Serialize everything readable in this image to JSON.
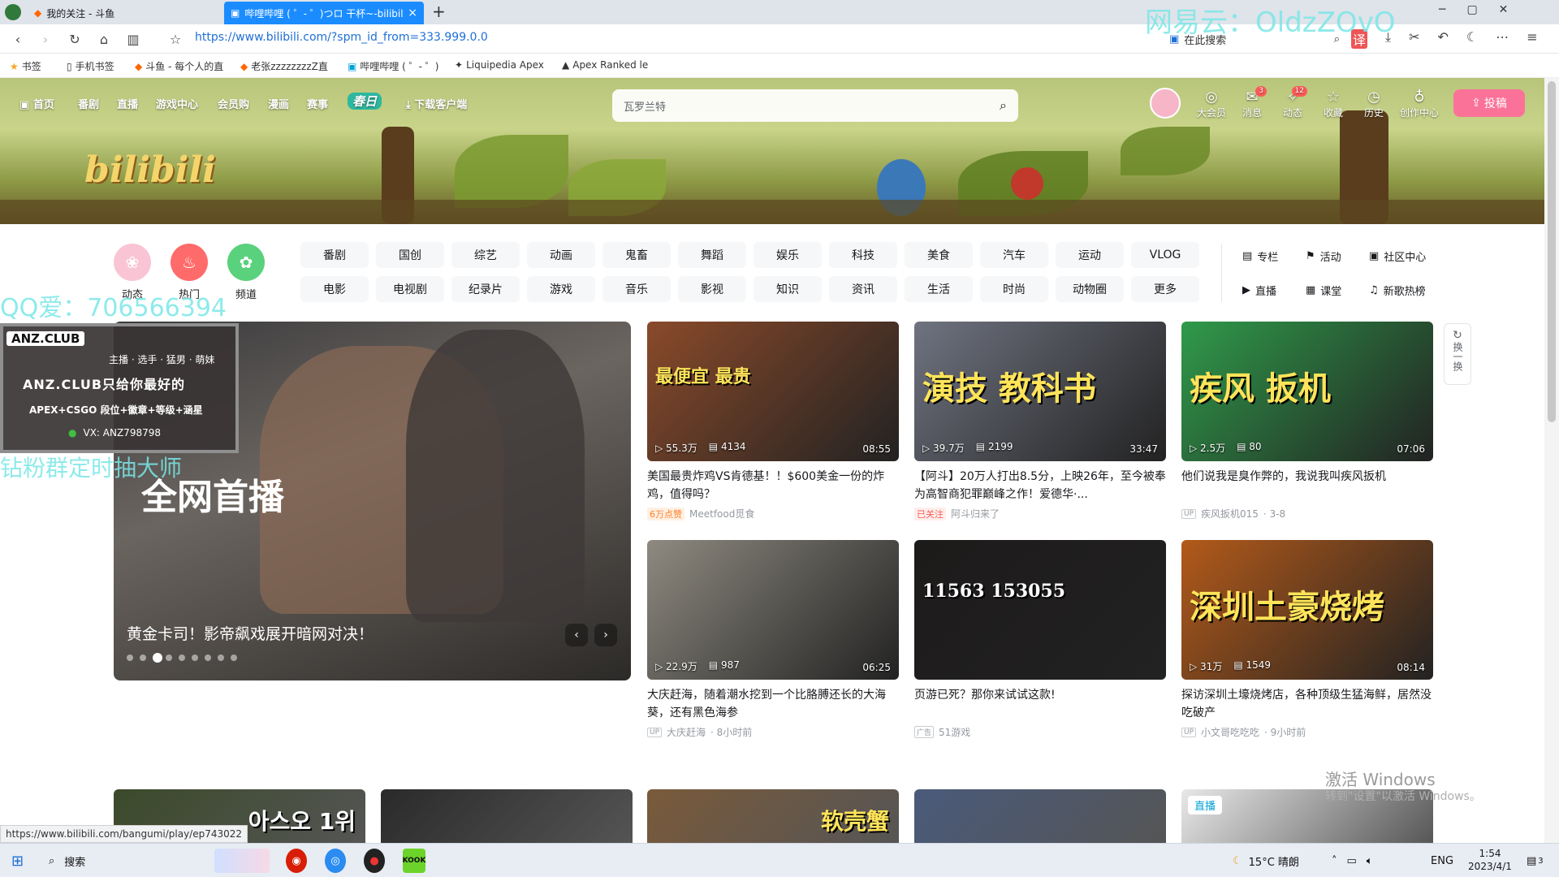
{
  "browser": {
    "tabs": [
      {
        "label": "我的关注 - 斗鱼"
      },
      {
        "label": "哔哩哔哩 ( ゜- ゜)つロ 干杯~-bilibili"
      }
    ],
    "new_tab": "+",
    "url": "https://www.bilibili.com/?spm_id_from=333.999.0.0",
    "search_placeholder": "在此搜索",
    "bookmarks": [
      {
        "label": "书签"
      },
      {
        "label": "手机书签"
      },
      {
        "label": "斗鱼 - 每个人的直"
      },
      {
        "label": "老张zzzzzzzzZ直"
      },
      {
        "label": "哔哩哔哩 ( ゜- ゜)"
      },
      {
        "label": "Liquipedia Apex"
      },
      {
        "label": "Apex Ranked le"
      }
    ]
  },
  "header": {
    "nav": [
      {
        "label": "首页"
      },
      {
        "label": "番剧"
      },
      {
        "label": "直播"
      },
      {
        "label": "游戏中心"
      },
      {
        "label": "会员购"
      },
      {
        "label": "漫画"
      },
      {
        "label": "赛事"
      },
      {
        "label": "春日"
      },
      {
        "label": "下载客户端"
      }
    ],
    "search_placeholder": "瓦罗兰特",
    "right": [
      {
        "label": "大会员",
        "icon": "vip-icon",
        "badge": ""
      },
      {
        "label": "消息",
        "icon": "message-icon",
        "badge": "3"
      },
      {
        "label": "动态",
        "icon": "dynamic-icon",
        "badge": "12"
      },
      {
        "label": "收藏",
        "icon": "star-icon",
        "badge": ""
      },
      {
        "label": "历史",
        "icon": "history-icon",
        "badge": ""
      },
      {
        "label": "创作中心",
        "icon": "bulb-icon",
        "badge": ""
      }
    ],
    "upload": "投稿",
    "logo": "bilibili"
  },
  "channels": {
    "circles": [
      {
        "label": "动态",
        "color": "#f9c5d4"
      },
      {
        "label": "热门",
        "color": "#ff6b6b"
      },
      {
        "label": "频道",
        "color": "#5ad17c"
      }
    ],
    "row1": [
      "番剧",
      "国创",
      "综艺",
      "动画",
      "鬼畜",
      "舞蹈",
      "娱乐",
      "科技",
      "美食",
      "汽车",
      "运动",
      "VLOG"
    ],
    "row2": [
      "电影",
      "电视剧",
      "纪录片",
      "游戏",
      "音乐",
      "影视",
      "知识",
      "资讯",
      "生活",
      "时尚",
      "动物圈",
      "更多"
    ],
    "side": [
      "专栏",
      "活动",
      "社区中心",
      "直播",
      "课堂",
      "新歌热榜"
    ]
  },
  "carousel": {
    "title": "黄金卡司！影帝飙戏展开暗网对决！",
    "overlay_text": "全网首播",
    "dot_count": 9,
    "active_dot": 2
  },
  "videos": [
    {
      "views": "55.3万",
      "danmaku": "4134",
      "duration": "08:55",
      "title": "美国最贵炸鸡VS肯德基！！$600美金一份的炸鸡，值得吗？",
      "tag": "6万点赞",
      "tag_type": "orange",
      "author": "Meetfood觅食",
      "date": "",
      "thumb_text": "最便宜    最贵",
      "thumb_color": "#8a4a2a"
    },
    {
      "views": "39.7万",
      "danmaku": "2199",
      "duration": "33:47",
      "title": "【阿斗】20万人打出8.5分，上映26年，至今被奉为高智商犯罪巅峰之作！爱德华·...",
      "tag": "已关注",
      "tag_type": "red",
      "author": "阿斗归来了",
      "date": "",
      "thumb_text": "演技 教科书",
      "thumb_color": "#6f7380"
    },
    {
      "views": "2.5万",
      "danmaku": "80",
      "duration": "07:06",
      "title": "他们说我是臭作弊的，我说我叫疾风扳机",
      "tag": "",
      "tag_type": "",
      "author": "疾风扳机015",
      "date": "3-8",
      "thumb_text": "疾风 扳机",
      "thumb_color": "#2f9a4a"
    },
    {
      "views": "22.9万",
      "danmaku": "987",
      "duration": "06:25",
      "title": "大庆赶海，随着潮水挖到一个比胳膊还长的大海葵，还有黑色海参",
      "tag": "",
      "tag_type": "",
      "author": "大庆赶海",
      "date": "8小时前",
      "thumb_text": "",
      "thumb_color": "#8e8a80"
    },
    {
      "views": "",
      "danmaku": "",
      "duration": "",
      "title": "页游已死？那你来试试这款!",
      "tag": "广告",
      "tag_type": "ad",
      "author": "51游戏",
      "date": "",
      "thumb_text": "11563    153055",
      "thumb_color": "#1d1a1a"
    },
    {
      "views": "31万",
      "danmaku": "1549",
      "duration": "08:14",
      "title": "探访深圳土壕烧烤店，各种顶级生猛海鲜，居然没吃破产",
      "tag": "",
      "tag_type": "",
      "author": "小文哥吃吃吃",
      "date": "9小时前",
      "thumb_text": "深圳土豪烧烤",
      "thumb_color": "#b35a1a"
    }
  ],
  "refresh_label": "换一换",
  "bottom_row": [
    {
      "text": "아스오 1위",
      "color": "#3b4a2a"
    },
    {
      "text": "",
      "color": "#2a2a2a"
    },
    {
      "text": "软壳蟹",
      "color": "#7a5a3a"
    },
    {
      "text": "",
      "color": "#4a5a7a"
    },
    {
      "text": "直播",
      "color": "#e8e8e8"
    }
  ],
  "overlays": {
    "watermark_top": "网易云：OldzZOvO",
    "watermark_qq": "QQ爱：706566394",
    "watermark_fans": "钻粉群定时抽大师",
    "ad_brand": "ANZ.CLUB",
    "ad_line1": "主播 · 选手 · 猛男 · 萌妹",
    "ad_line2": "ANZ.CLUB只给你最好的",
    "ad_line3": "APEX+CSGO 段位+徽章+等级+涵星",
    "ad_line4": "VX: ANZ798798",
    "activate_title": "激活 Windows",
    "activate_sub": "转到\"设置\"以激活 Windows。"
  },
  "status_url": "https://www.bilibili.com/bangumi/play/ep743022",
  "taskbar": {
    "search": "搜索",
    "weather": "15°C  晴朗",
    "lang": "ENG",
    "time": "1:54",
    "date": "2023/4/1",
    "notif": "3"
  }
}
